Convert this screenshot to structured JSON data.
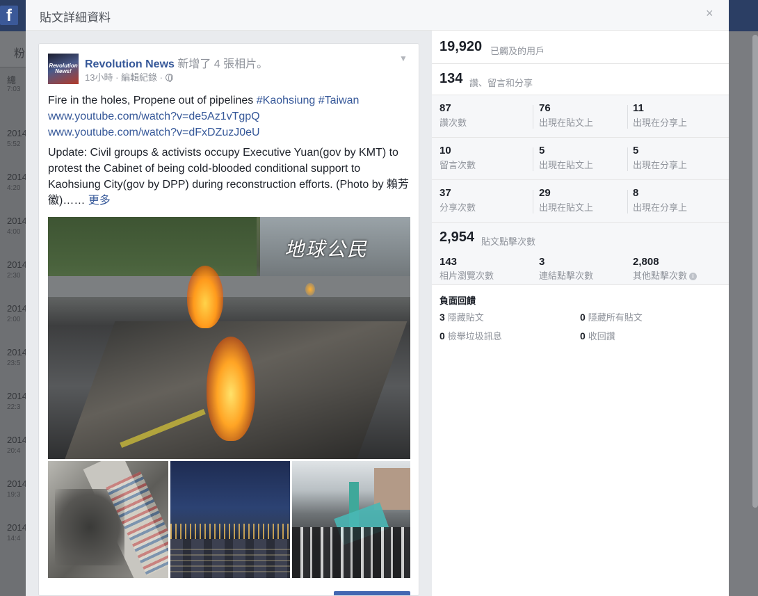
{
  "background": {
    "left_header": "粉",
    "left_subheader": "總",
    "rows": [
      {
        "date": "7:03",
        "time": ""
      },
      {
        "date": "2014",
        "time": "5:52"
      },
      {
        "date": "2014",
        "time": "4:20"
      },
      {
        "date": "2014",
        "time": "4:00"
      },
      {
        "date": "2014",
        "time": "2:30"
      },
      {
        "date": "2014",
        "time": "2:00"
      },
      {
        "date": "2014",
        "time": "23:5"
      },
      {
        "date": "2014",
        "time": "22:3"
      },
      {
        "date": "2014",
        "time": "20:4"
      },
      {
        "date": "2014",
        "time": "19:3"
      },
      {
        "date": "2014",
        "time": "14:4"
      }
    ]
  },
  "modal": {
    "title": "貼文詳細資料",
    "close_glyph": "×"
  },
  "post": {
    "avatar_text": "Revolution News!",
    "page_name": "Revolution News",
    "header_rest": " 新增了 4 張相片。",
    "meta": "13小時 · 編輯紀錄 · ",
    "line1_text": "Fire in the holes, Propene out of pipelines ",
    "hashtag1": "#Kaohsiung",
    "hashtag2": "#Taiwan",
    "link1": "www.youtube.com/watch?v=de5Az1vTgpQ",
    "link2": "www.youtube.com/watch?v=dFxDZuzJ0eU",
    "update_text": "Update: Civil groups & activists occupy Executive Yuan(gov by KMT) to protest the Cabinet of being cold-blooded conditional support to Kaohsiung City(gov by DPP) during reconstruction efforts. (Photo by 賴芳徽)……",
    "more_label": "更多",
    "photo_watermark": "地球公民"
  },
  "stats": {
    "reach": {
      "value": "19,920",
      "label": "已觸及的用戶"
    },
    "engagement": {
      "value": "134",
      "label": "讚、留言和分享"
    },
    "grid": [
      {
        "total": "87",
        "total_label": "讚次數",
        "on_post": "76",
        "on_post_label": "出現在貼文上",
        "on_shares": "11",
        "on_shares_label": "出現在分享上"
      },
      {
        "total": "10",
        "total_label": "留言次數",
        "on_post": "5",
        "on_post_label": "出現在貼文上",
        "on_shares": "5",
        "on_shares_label": "出現在分享上"
      },
      {
        "total": "37",
        "total_label": "分享次數",
        "on_post": "29",
        "on_post_label": "出現在貼文上",
        "on_shares": "8",
        "on_shares_label": "出現在分享上"
      }
    ],
    "post_clicks": {
      "value": "2,954",
      "label": "貼文點擊次數"
    },
    "clicks_breakdown": [
      {
        "value": "143",
        "label": "相片瀏覽次數"
      },
      {
        "value": "3",
        "label": "連結點擊次數"
      },
      {
        "value": "2,808",
        "label": "其他點擊次數"
      }
    ],
    "negative": {
      "title": "負面回饋",
      "items": [
        {
          "value": "3",
          "label": "隱藏貼文"
        },
        {
          "value": "0",
          "label": "隱藏所有貼文"
        },
        {
          "value": "0",
          "label": "檢舉垃圾訊息"
        },
        {
          "value": "0",
          "label": "收回讚"
        }
      ]
    }
  }
}
